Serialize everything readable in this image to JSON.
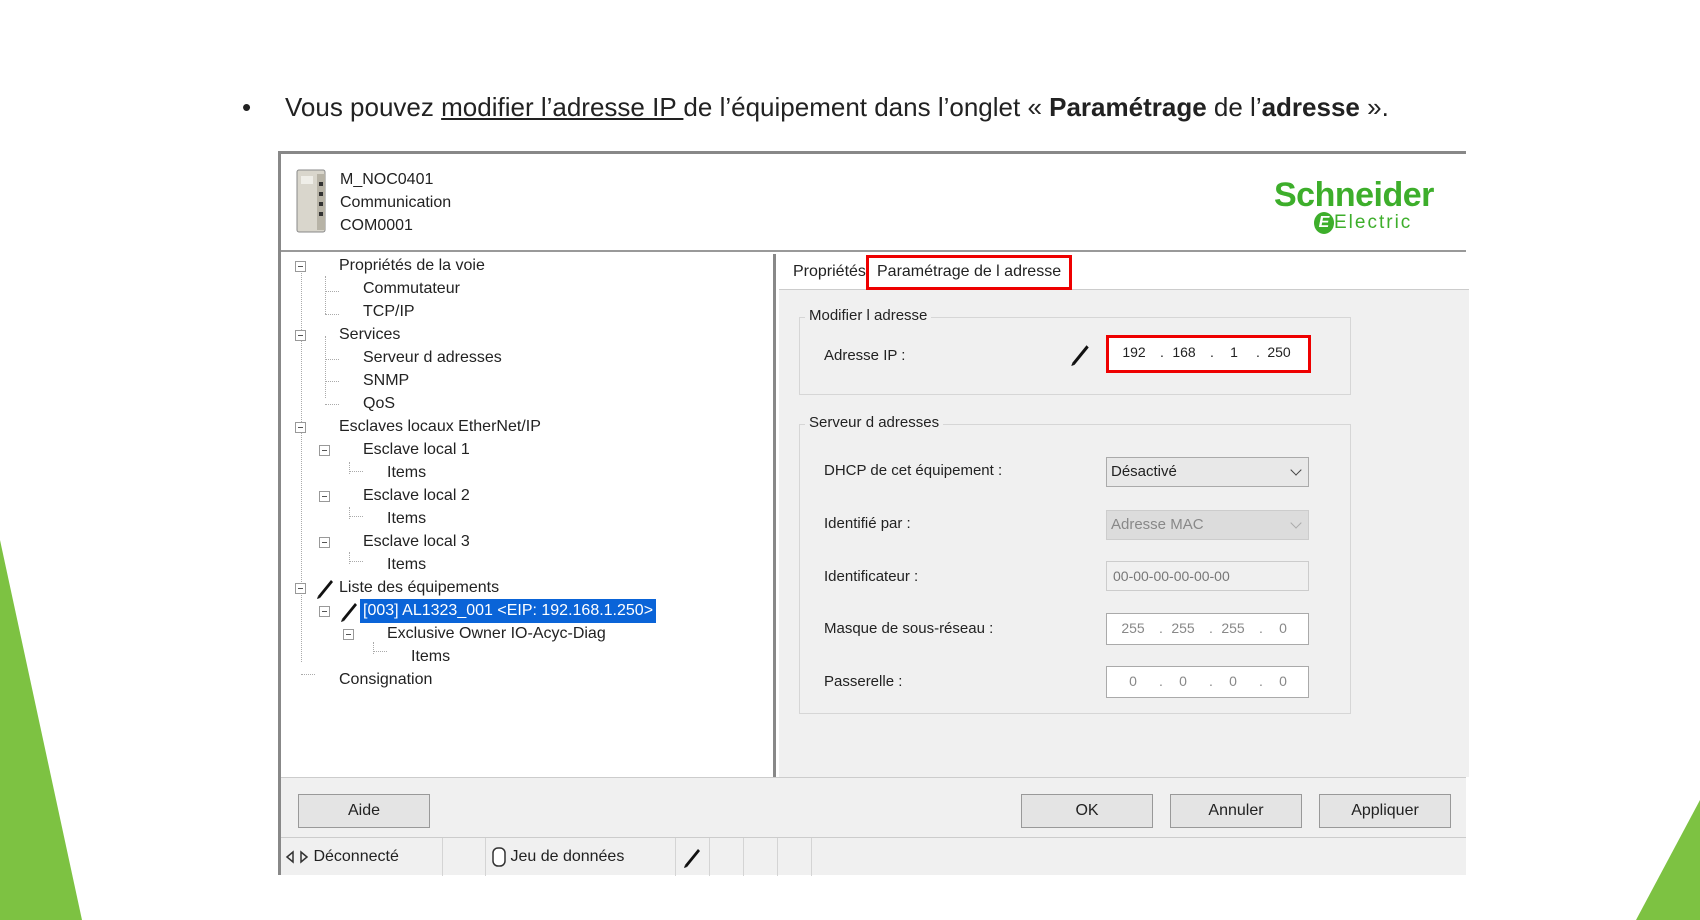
{
  "slide": {
    "bullet": "•",
    "text_before": "Vous pouvez ",
    "text_link": "modifier l’adresse IP ",
    "text_mid1": "de l’équipement dans l’onglet « ",
    "text_bold1": "Paramétrage",
    "text_mid2": " de l’",
    "text_bold2": "adresse",
    "text_end": " »."
  },
  "header": {
    "line1": "M_NOC0401",
    "line2": "Communication",
    "line3": "COM0001",
    "logo_top": "Schneider",
    "logo_bottom": "Electric",
    "brand_color": "#3dae2b"
  },
  "tree": {
    "items": [
      {
        "label": "Propriétés de la voie"
      },
      {
        "label": "Commutateur"
      },
      {
        "label": "TCP/IP"
      },
      {
        "label": "Services"
      },
      {
        "label": "Serveur d adresses"
      },
      {
        "label": "SNMP"
      },
      {
        "label": "QoS"
      },
      {
        "label": "Esclaves locaux EtherNet/IP"
      },
      {
        "label": "Esclave local 1"
      },
      {
        "label": "Items"
      },
      {
        "label": "Esclave local 2"
      },
      {
        "label": "Items"
      },
      {
        "label": "Esclave local 3"
      },
      {
        "label": "Items"
      },
      {
        "label": "Liste des équipements"
      },
      {
        "label": "[003] AL1323_001 <EIP: 192.168.1.250>"
      },
      {
        "label": "Exclusive Owner IO-Acyc-Diag"
      },
      {
        "label": "Items"
      },
      {
        "label": "Consignation"
      }
    ]
  },
  "tabs": [
    {
      "label": "Propriétés"
    },
    {
      "label": "Paramétrage de l adresse"
    }
  ],
  "modify_group": {
    "title": "Modifier l adresse",
    "ip_label": "Adresse IP :",
    "ip": [
      "192",
      "168",
      "1",
      "250"
    ]
  },
  "server_group": {
    "title": "Serveur d adresses",
    "dhcp_label": "DHCP de cet équipement :",
    "dhcp_value": "Désactivé",
    "identified_label": "Identifié par :",
    "identified_value": "Adresse MAC",
    "identifier_label": "Identificateur :",
    "identifier_value": "00-00-00-00-00-00",
    "mask_label": "Masque de sous-réseau :",
    "mask": [
      "255",
      "255",
      "255",
      "0"
    ],
    "gateway_label": "Passerelle :",
    "gateway": [
      "0",
      "0",
      "0",
      "0"
    ]
  },
  "buttons": {
    "help": "Aide",
    "ok": "OK",
    "cancel": "Annuler",
    "apply": "Appliquer"
  },
  "status": {
    "connection": "Déconnecté",
    "dataset": "Jeu de données"
  },
  "colors": {
    "highlight_red": "#e00000",
    "selection_blue": "#0a64d8",
    "slide_green": "#7dc242"
  }
}
